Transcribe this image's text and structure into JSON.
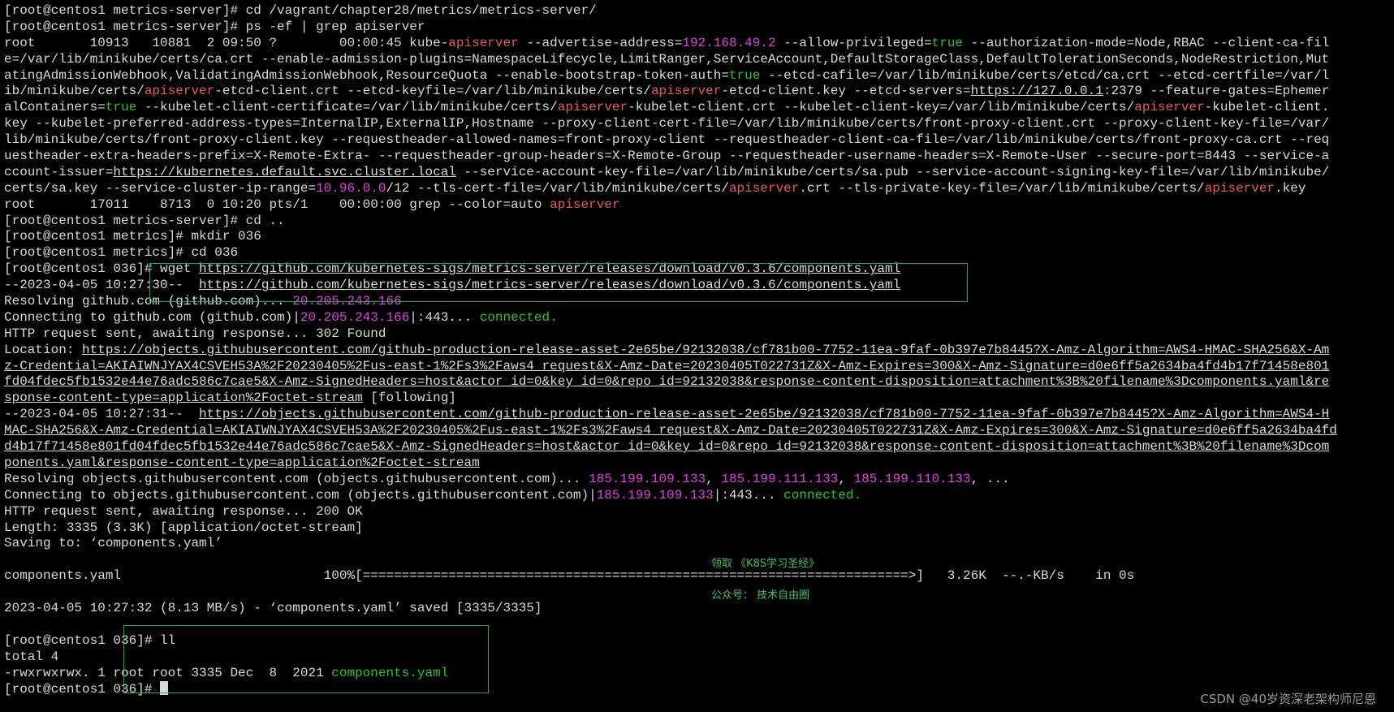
{
  "terminal": {
    "lines": [
      [
        {
          "t": "[root@centos1 metrics-server]# cd /vagrant/chapter28/metrics/metrics-server/"
        }
      ],
      [
        {
          "t": "[root@centos1 metrics-server]# ps -ef | grep apiserver"
        }
      ],
      [
        {
          "t": "root       10913   10881  2 09:50 ?        00:00:45 kube-"
        },
        {
          "t": "apiserver",
          "c": "r"
        },
        {
          "t": " --advertise-address="
        },
        {
          "t": "192.168.49.2",
          "c": "p"
        },
        {
          "t": " --allow-privileged="
        },
        {
          "t": "true",
          "c": "g"
        },
        {
          "t": " --authorization-mode=Node,RBAC --client-ca-fil"
        }
      ],
      [
        {
          "t": "e=/var/lib/minikube/certs/ca.crt --enable-admission-plugins=NamespaceLifecycle,LimitRanger,ServiceAccount,DefaultStorageClass,DefaultTolerationSeconds,NodeRestriction,Mut"
        }
      ],
      [
        {
          "t": "atingAdmissionWebhook,ValidatingAdmissionWebhook,ResourceQuota --enable-bootstrap-token-auth="
        },
        {
          "t": "true",
          "c": "g"
        },
        {
          "t": " --etcd-cafile=/var/lib/minikube/certs/etcd/ca.crt --etcd-certfile=/var/l"
        }
      ],
      [
        {
          "t": "ib/minikube/certs/"
        },
        {
          "t": "apiserver",
          "c": "r"
        },
        {
          "t": "-etcd-client.crt --etcd-keyfile=/var/lib/minikube/certs/"
        },
        {
          "t": "apiserver",
          "c": "r"
        },
        {
          "t": "-etcd-client.key --etcd-servers="
        },
        {
          "t": "https://127.0.0.1",
          "c": "u"
        },
        {
          "t": ":2379 --feature-gates=Ephemer"
        }
      ],
      [
        {
          "t": "alContainers="
        },
        {
          "t": "true",
          "c": "g"
        },
        {
          "t": " --kubelet-client-certificate=/var/lib/minikube/certs/"
        },
        {
          "t": "apiserver",
          "c": "r"
        },
        {
          "t": "-kubelet-client.crt --kubelet-client-key=/var/lib/minikube/certs/"
        },
        {
          "t": "apiserver",
          "c": "r"
        },
        {
          "t": "-kubelet-client."
        }
      ],
      [
        {
          "t": "key --kubelet-preferred-address-types=InternalIP,ExternalIP,Hostname --proxy-client-cert-file=/var/lib/minikube/certs/front-proxy-client.crt --proxy-client-key-file=/var/"
        }
      ],
      [
        {
          "t": "lib/minikube/certs/front-proxy-client.key --requestheader-allowed-names=front-proxy-client --requestheader-client-ca-file=/var/lib/minikube/certs/front-proxy-ca.crt --req"
        }
      ],
      [
        {
          "t": "uestheader-extra-headers-prefix=X-Remote-Extra- --requestheader-group-headers=X-Remote-Group --requestheader-username-headers=X-Remote-User --secure-port=8443 --service-a"
        }
      ],
      [
        {
          "t": "ccount-issuer="
        },
        {
          "t": "https://kubernetes.default.svc.cluster.local",
          "c": "u"
        },
        {
          "t": " --service-account-key-file=/var/lib/minikube/certs/sa.pub --service-account-signing-key-file=/var/lib/minikube/"
        }
      ],
      [
        {
          "t": "certs/sa.key --service-cluster-ip-range="
        },
        {
          "t": "10.96.0.0",
          "c": "p"
        },
        {
          "t": "/12 --tls-cert-file=/var/lib/minikube/certs/"
        },
        {
          "t": "apiserver",
          "c": "r"
        },
        {
          "t": ".crt --tls-private-key-file=/var/lib/minikube/certs/"
        },
        {
          "t": "apiserver",
          "c": "r"
        },
        {
          "t": ".key"
        }
      ],
      [
        {
          "t": "root       17011    8713  0 10:20 pts/1    00:00:00 grep --color=auto "
        },
        {
          "t": "apiserver",
          "c": "r"
        }
      ],
      [
        {
          "t": "[root@centos1 metrics-server]# cd .."
        }
      ],
      [
        {
          "t": "[root@centos1 metrics]# mkdir 036"
        }
      ],
      [
        {
          "t": "[root@centos1 metrics]# cd 036"
        }
      ],
      [
        {
          "t": "[root@centos1 036]# wget "
        },
        {
          "t": "https://github.com/kubernetes-sigs/metrics-server/releases/download/v0.3.6/components.yaml",
          "c": "u"
        }
      ],
      [
        {
          "t": "--2023-04-05 10:27:30--  "
        },
        {
          "t": "https://github.com/kubernetes-sigs/metrics-server/releases/download/v0.3.6/components.yaml",
          "c": "u"
        }
      ],
      [
        {
          "t": "Resolving github.com (github.com)... "
        },
        {
          "t": "20.205.243.166",
          "c": "p"
        }
      ],
      [
        {
          "t": "Connecting to github.com (github.com)|"
        },
        {
          "t": "20.205.243.166",
          "c": "p"
        },
        {
          "t": "|:443... "
        },
        {
          "t": "connected.",
          "c": "g"
        }
      ],
      [
        {
          "t": "HTTP request sent, awaiting response... 302 Found"
        }
      ],
      [
        {
          "t": "Location: "
        },
        {
          "t": "https://objects.githubusercontent.com/github-production-release-asset-2e65be/92132038/cf781b00-7752-11ea-9faf-0b397e7b8445?X-Amz-Algorithm=AWS4-HMAC-SHA256&X-Am",
          "c": "u"
        }
      ],
      [
        {
          "t": "z-Credential=AKIAIWNJYAX4CSVEH53A%2F20230405%2Fus-east-1%2Fs3%2Faws4_request&X-Amz-Date=20230405T022731Z&X-Amz-Expires=300&X-Amz-Signature=d0e6ff5a2634ba4fd4b17f71458e801",
          "c": "u"
        }
      ],
      [
        {
          "t": "fd04fdec5fb1532e44e76adc586c7cae5&X-Amz-SignedHeaders=host&actor_id=0&key_id=0&repo_id=92132038&response-content-disposition=attachment%3B%20filename%3Dcomponents.yaml&re",
          "c": "u"
        }
      ],
      [
        {
          "t": "sponse-content-type=application%2Foctet-stream",
          "c": "u"
        },
        {
          "t": " [following]"
        }
      ],
      [
        {
          "t": "--2023-04-05 10:27:31--  "
        },
        {
          "t": "https://objects.githubusercontent.com/github-production-release-asset-2e65be/92132038/cf781b00-7752-11ea-9faf-0b397e7b8445?X-Amz-Algorithm=AWS4-H",
          "c": "u"
        }
      ],
      [
        {
          "t": "MAC-SHA256&X-Amz-Credential=AKIAIWNJYAX4CSVEH53A%2F20230405%2Fus-east-1%2Fs3%2Faws4_request&X-Amz-Date=20230405T022731Z&X-Amz-Expires=300&X-Amz-Signature=d0e6ff5a2634ba4fd",
          "c": "u"
        }
      ],
      [
        {
          "t": "d4b17f71458e801fd04fdec5fb1532e44e76adc586c7cae5&X-Amz-SignedHeaders=host&actor_id=0&key_id=0&repo_id=92132038&response-content-disposition=attachment%3B%20filename%3Dcom",
          "c": "u"
        }
      ],
      [
        {
          "t": "ponents.yaml&response-content-type=application%2Foctet-stream",
          "c": "u"
        }
      ],
      [
        {
          "t": "Resolving objects.githubusercontent.com (objects.githubusercontent.com)... "
        },
        {
          "t": "185.199.109.133",
          "c": "p"
        },
        {
          "t": ", "
        },
        {
          "t": "185.199.111.133",
          "c": "p"
        },
        {
          "t": ", "
        },
        {
          "t": "185.199.110.133",
          "c": "p"
        },
        {
          "t": ", ..."
        }
      ],
      [
        {
          "t": "Connecting to objects.githubusercontent.com (objects.githubusercontent.com)|"
        },
        {
          "t": "185.199.109.133",
          "c": "p"
        },
        {
          "t": "|:443... "
        },
        {
          "t": "connected.",
          "c": "g"
        }
      ],
      [
        {
          "t": "HTTP request sent, awaiting response... 200 OK"
        }
      ],
      [
        {
          "t": "Length: 3335 (3.3K) [application/octet-stream]"
        }
      ],
      [
        {
          "t": "Saving to: ‘components.yaml’"
        }
      ],
      [
        {
          "t": ""
        }
      ],
      [
        {
          "t": "components.yaml                          100%[======================================================================>]   3.26K  --.-KB/s    in 0s"
        }
      ],
      [
        {
          "t": ""
        }
      ],
      [
        {
          "t": "2023-04-05 10:27:32 (8.13 MB/s) - ‘components.yaml’ saved [3335/3335]"
        }
      ],
      [
        {
          "t": ""
        }
      ],
      [
        {
          "t": "[root@centos1 036]# ll"
        }
      ],
      [
        {
          "t": "total 4"
        }
      ],
      [
        {
          "t": "-rwxrwxrwx. 1 root root 3335 Dec  8  2021 "
        },
        {
          "t": "components.yaml",
          "c": "g"
        }
      ],
      [
        {
          "t": "[root@centos1 036]# "
        }
      ]
    ]
  },
  "overlay": {
    "promo_line1": "领取 《K8S学习圣经》",
    "promo_line2": "公众号： 技术自由圈"
  },
  "watermark": "CSDN @40岁资深老架构师尼恩",
  "colors": {
    "background": "#000000",
    "text": "#d9d9d9",
    "ip_magenta": "#e040e0",
    "keyword_red": "#e85a5a",
    "bool_green": "#26c726",
    "highlight_box": "#27a84a"
  }
}
